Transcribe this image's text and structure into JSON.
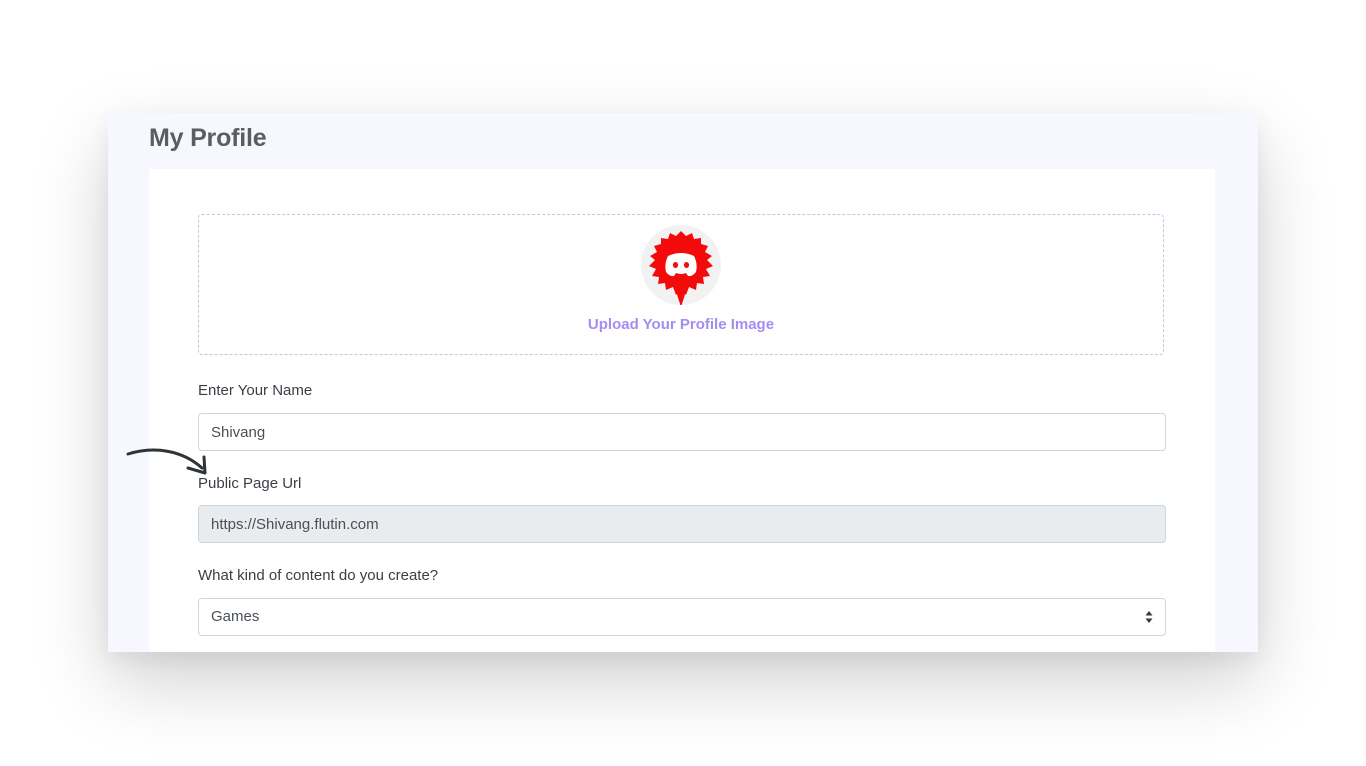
{
  "page": {
    "title": "My Profile"
  },
  "upload": {
    "label": "Upload Your Profile Image",
    "avatar_icon": "red-discord-bearded-mascot-icon",
    "accent_color": "#a48df0"
  },
  "form": {
    "name": {
      "label": "Enter Your Name",
      "value": "Shivang"
    },
    "public_url": {
      "label": "Public Page Url",
      "value": "https://Shivang.flutin.com"
    },
    "content_type": {
      "label": "What kind of content do you create?",
      "selected": "Games"
    }
  },
  "annotation": {
    "icon": "curved-arrow-icon"
  }
}
